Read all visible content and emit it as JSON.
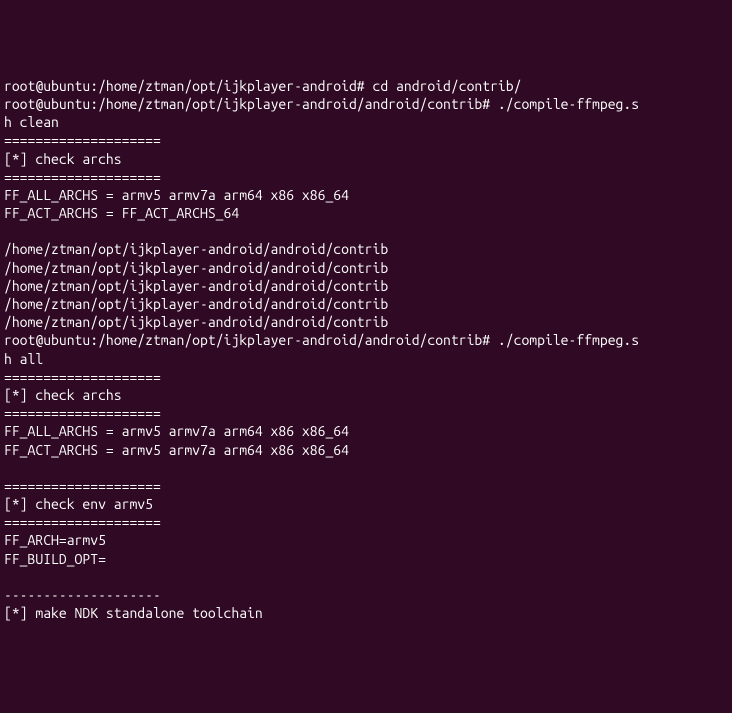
{
  "lines": [
    {
      "prompt": "root@ubuntu",
      "path": ":/home/ztman/opt/ijkplayer-android#",
      "cmd": " cd android/contrib/"
    },
    {
      "prompt": "root@ubuntu",
      "path": ":/home/ztman/opt/ijkplayer-android/android/contrib#",
      "cmd": " ./compile-ffmpeg.s"
    },
    {
      "text": "h clean"
    },
    {
      "text": "===================="
    },
    {
      "text": "[*] check archs"
    },
    {
      "text": "===================="
    },
    {
      "text": "FF_ALL_ARCHS = armv5 armv7a arm64 x86 x86_64"
    },
    {
      "text": "FF_ACT_ARCHS = FF_ACT_ARCHS_64"
    },
    {
      "text": ""
    },
    {
      "text": "/home/ztman/opt/ijkplayer-android/android/contrib"
    },
    {
      "text": "/home/ztman/opt/ijkplayer-android/android/contrib"
    },
    {
      "text": "/home/ztman/opt/ijkplayer-android/android/contrib"
    },
    {
      "text": "/home/ztman/opt/ijkplayer-android/android/contrib"
    },
    {
      "text": "/home/ztman/opt/ijkplayer-android/android/contrib"
    },
    {
      "prompt": "root@ubuntu",
      "path": ":/home/ztman/opt/ijkplayer-android/android/contrib#",
      "cmd": " ./compile-ffmpeg.s"
    },
    {
      "text": "h all"
    },
    {
      "text": "===================="
    },
    {
      "text": "[*] check archs"
    },
    {
      "text": "===================="
    },
    {
      "text": "FF_ALL_ARCHS = armv5 armv7a arm64 x86 x86_64"
    },
    {
      "text": "FF_ACT_ARCHS = armv5 armv7a arm64 x86 x86_64"
    },
    {
      "text": ""
    },
    {
      "text": "===================="
    },
    {
      "text": "[*] check env armv5"
    },
    {
      "text": "===================="
    },
    {
      "text": "FF_ARCH=armv5"
    },
    {
      "text": "FF_BUILD_OPT="
    },
    {
      "text": ""
    },
    {
      "text": "--------------------"
    },
    {
      "text": "[*] make NDK standalone toolchain"
    }
  ]
}
